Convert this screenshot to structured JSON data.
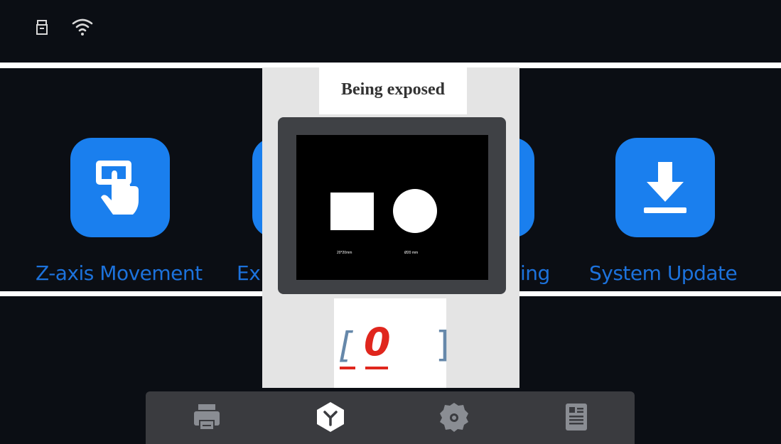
{
  "status_bar": {
    "icons": [
      "usb-icon",
      "wifi-icon"
    ]
  },
  "tools": [
    {
      "label": "Z-axis Movement",
      "icon": "hand-touch-icon"
    },
    {
      "label": "Ex",
      "icon": "exposure-icon"
    },
    {
      "label": "ing",
      "icon": "leveling-icon"
    },
    {
      "label": "System Update",
      "icon": "download-icon"
    }
  ],
  "dialog": {
    "title": "Being exposed",
    "screen_caption_square": "20*20mm",
    "screen_caption_circle": "Ø20 mm",
    "count": "0",
    "bracket_open": "[",
    "bracket_close": "]"
  },
  "taskbar": {
    "icons": [
      "printer-icon",
      "tools-cube-icon",
      "settings-gear-icon",
      "info-document-icon"
    ]
  },
  "colors": {
    "background": "#0b0e14",
    "accent_blue": "#1a7fee",
    "label_blue": "#1c72dc",
    "counter_red": "#e0261d",
    "taskbar": "#3a3b3f"
  }
}
